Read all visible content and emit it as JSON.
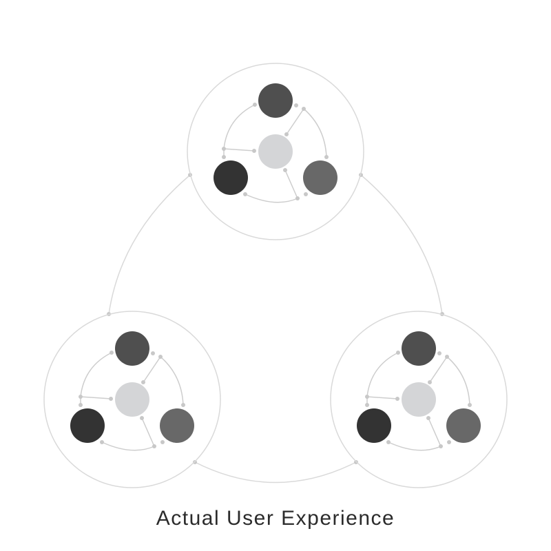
{
  "caption": "Actual User Experience",
  "colors": {
    "ring": "#d9d9d9",
    "connector": "#cdcdcd",
    "dot": "#c8c8c8",
    "center_node": "#d4d5d7",
    "node_top": "#4f4f4f",
    "node_left": "#333333",
    "node_right": "#686868",
    "caption": "#2b2b2b"
  },
  "clusters": [
    {
      "id": "top-cluster"
    },
    {
      "id": "bottom-left-cluster"
    },
    {
      "id": "bottom-right-cluster"
    }
  ]
}
